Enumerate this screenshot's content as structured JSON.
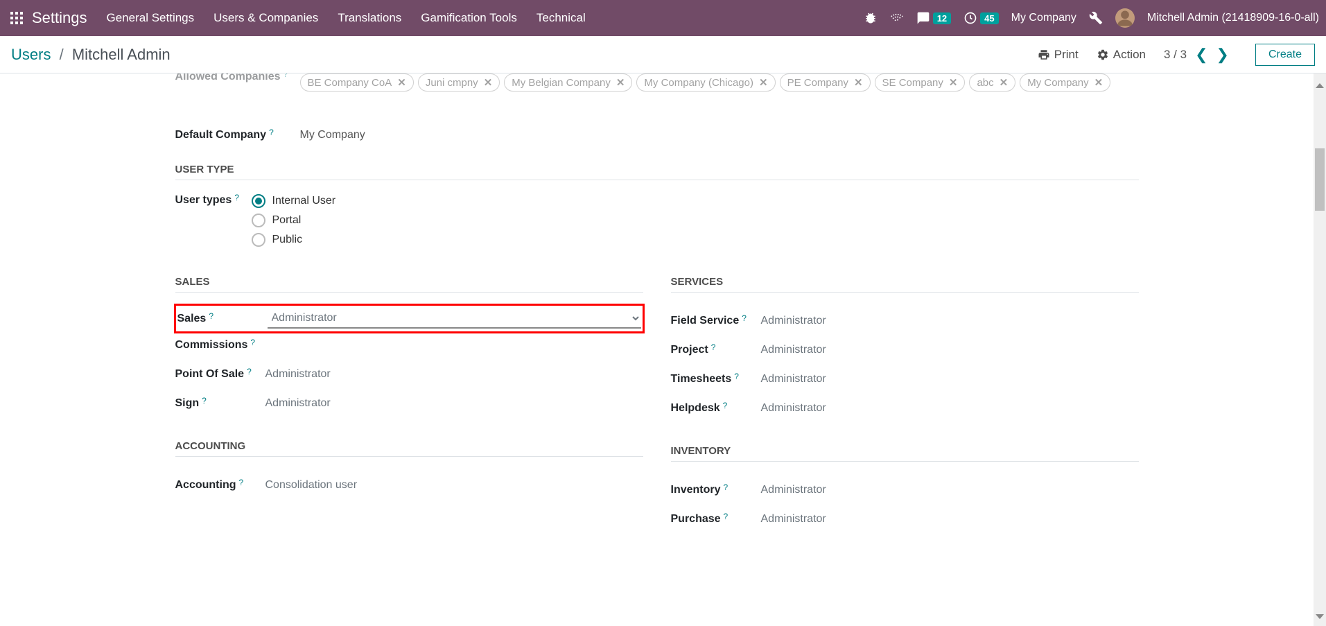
{
  "nav": {
    "brand": "Settings",
    "menu": [
      "General Settings",
      "Users & Companies",
      "Translations",
      "Gamification Tools",
      "Technical"
    ],
    "msg_badge": "12",
    "timer_badge": "45",
    "company": "My Company",
    "user_name": "Mitchell Admin (21418909-16-0-all)"
  },
  "breadcrumb": {
    "root": "Users",
    "current": "Mitchell Admin"
  },
  "actions": {
    "print": "Print",
    "action": "Action",
    "pager": "3 / 3",
    "create": "Create"
  },
  "form": {
    "allowed_companies_label": "Allowed Companies",
    "allowed_companies": [
      "BE Company CoA",
      "Juni cmpny",
      "My Belgian Company",
      "My Company (Chicago)",
      "PE Company",
      "SE Company",
      "abc",
      "My Company"
    ],
    "default_company_label": "Default Company",
    "default_company_value": "My Company",
    "user_type_section": "USER TYPE",
    "user_types_label": "User types",
    "user_types": {
      "opts": [
        "Internal User",
        "Portal",
        "Public"
      ],
      "selected_index": 0
    },
    "cols": {
      "left": [
        {
          "section": "SALES"
        },
        {
          "label": "Sales",
          "value": "Administrator",
          "highlight": true,
          "dropdown": true
        },
        {
          "label": "Commissions",
          "value": ""
        },
        {
          "label": "Point Of Sale",
          "value": "Administrator"
        },
        {
          "label": "Sign",
          "value": "Administrator"
        },
        {
          "section": "ACCOUNTING"
        },
        {
          "label": "Accounting",
          "value": "Consolidation user"
        }
      ],
      "right": [
        {
          "section": "SERVICES"
        },
        {
          "label": "Field Service",
          "value": "Administrator"
        },
        {
          "label": "Project",
          "value": "Administrator"
        },
        {
          "label": "Timesheets",
          "value": "Administrator"
        },
        {
          "label": "Helpdesk",
          "value": "Administrator"
        },
        {
          "section": "INVENTORY"
        },
        {
          "label": "Inventory",
          "value": "Administrator"
        },
        {
          "label": "Purchase",
          "value": "Administrator"
        }
      ]
    }
  }
}
